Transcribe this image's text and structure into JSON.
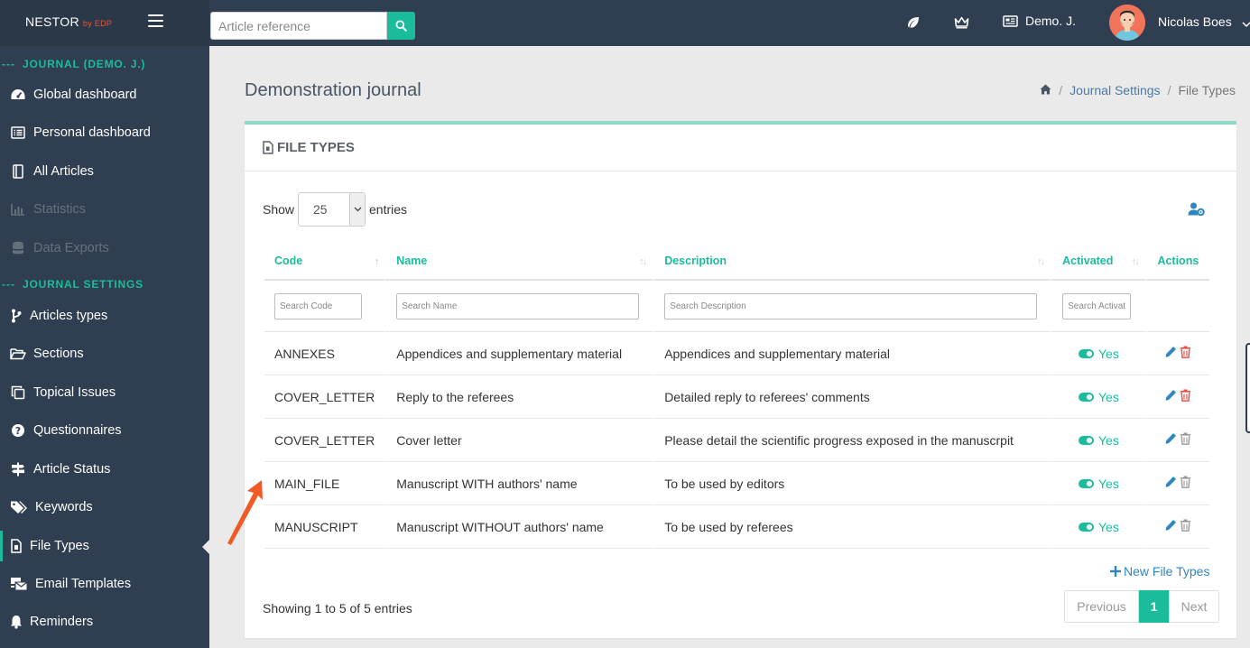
{
  "brand": {
    "name": "NESTOR",
    "sub": "by EDP"
  },
  "search": {
    "placeholder": "Article reference"
  },
  "header": {
    "journal": "Demo. J.",
    "user": "Nicolas Boes"
  },
  "sidebar": {
    "heading_journal": "JOURNAL (DEMO. J.)",
    "heading_settings": "JOURNAL SETTINGS",
    "items": [
      {
        "label": "Global dashboard",
        "icon": "gauge-icon",
        "disabled": false
      },
      {
        "label": "Personal dashboard",
        "icon": "list-icon",
        "disabled": false
      },
      {
        "label": "All Articles",
        "icon": "book-icon",
        "disabled": false
      },
      {
        "label": "Statistics",
        "icon": "chart-icon",
        "disabled": true
      },
      {
        "label": "Data Exports",
        "icon": "database-icon",
        "disabled": true
      },
      {
        "label": "Articles types",
        "icon": "branch-icon",
        "disabled": false
      },
      {
        "label": "Sections",
        "icon": "folder-open-icon",
        "disabled": false
      },
      {
        "label": "Topical Issues",
        "icon": "copy-icon",
        "disabled": false
      },
      {
        "label": "Questionnaires",
        "icon": "question-circle-icon",
        "disabled": false
      },
      {
        "label": "Article Status",
        "icon": "signpost-icon",
        "disabled": false
      },
      {
        "label": "Keywords",
        "icon": "tags-icon",
        "disabled": false
      },
      {
        "label": "File Types",
        "icon": "file-icon",
        "disabled": false,
        "active": true
      },
      {
        "label": "Email Templates",
        "icon": "mail-bulk-icon",
        "disabled": false
      },
      {
        "label": "Reminders",
        "icon": "bell-icon",
        "disabled": false
      }
    ]
  },
  "main": {
    "title": "Demonstration journal",
    "breadcrumb": [
      "Journal Settings",
      "File Types"
    ],
    "panel_title": "FILE TYPES",
    "show_label": "Show",
    "page_size": "25",
    "entries_label": "entries",
    "columns": [
      "Code",
      "Name",
      "Description",
      "Activated",
      "Actions"
    ],
    "filters": [
      "Search Code",
      "Search Name",
      "Search Description",
      "Search Activated"
    ],
    "rows": [
      {
        "code": "ANNEXES",
        "name": "Appendices and supplementary material",
        "description": "Appendices and supplementary material",
        "activated": "Yes",
        "deletable": true
      },
      {
        "code": "COVER_LETTER",
        "name": "Reply to the referees",
        "description": "Detailed reply to referees' comments",
        "activated": "Yes",
        "deletable": true
      },
      {
        "code": "COVER_LETTER",
        "name": "Cover letter",
        "description": "Please detail the scientific progress exposed in the manuscrpit",
        "activated": "Yes",
        "deletable": false
      },
      {
        "code": "MAIN_FILE",
        "name": "Manuscript WITH authors' name",
        "description": "To be used by editors",
        "activated": "Yes",
        "deletable": false
      },
      {
        "code": "MANUSCRIPT",
        "name": "Manuscript WITHOUT authors' name",
        "description": "To be used by referees",
        "activated": "Yes",
        "deletable": false
      }
    ],
    "new_button": "New File Types",
    "info": "Showing 1 to 5 of 5 entries",
    "pager": {
      "previous": "Previous",
      "current": "1",
      "next": "Next"
    }
  },
  "colors": {
    "accent": "#1abc9c",
    "sidebar": "#2f3e50",
    "link": "#2e86c1",
    "delete": "#e74c3c",
    "annotation": "#f15a24"
  }
}
